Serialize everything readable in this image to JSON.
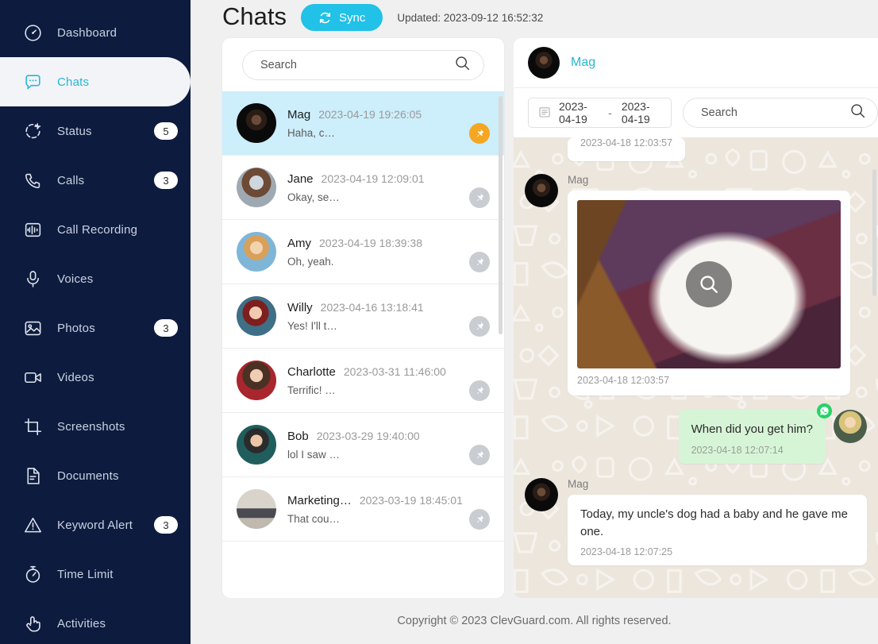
{
  "sidebar": {
    "items": [
      {
        "label": "Dashboard",
        "icon": "dashboard-icon",
        "badge": "",
        "active": false
      },
      {
        "label": "Chats",
        "icon": "chat-bubble-icon",
        "badge": "",
        "active": true
      },
      {
        "label": "Status",
        "icon": "status-plus-icon",
        "badge": "5",
        "active": false
      },
      {
        "label": "Calls",
        "icon": "phone-icon",
        "badge": "3",
        "active": false
      },
      {
        "label": "Call Recording",
        "icon": "waveform-icon",
        "badge": "",
        "active": false
      },
      {
        "label": "Voices",
        "icon": "microphone-icon",
        "badge": "",
        "active": false
      },
      {
        "label": "Photos",
        "icon": "photo-icon",
        "badge": "3",
        "active": false
      },
      {
        "label": "Videos",
        "icon": "video-camera-icon",
        "badge": "",
        "active": false
      },
      {
        "label": "Screenshots",
        "icon": "crop-icon",
        "badge": "",
        "active": false
      },
      {
        "label": "Documents",
        "icon": "document-icon",
        "badge": "",
        "active": false
      },
      {
        "label": "Keyword Alert",
        "icon": "warning-triangle-icon",
        "badge": "3",
        "active": false
      },
      {
        "label": "Time Limit",
        "icon": "stopwatch-icon",
        "badge": "",
        "active": false
      },
      {
        "label": "Activities",
        "icon": "hand-pointer-icon",
        "badge": "",
        "active": false
      }
    ]
  },
  "header": {
    "title": "Chats",
    "sync_label": "Sync",
    "sync_icon": "refresh-icon",
    "updated": "Updated: 2023-09-12 16:52:32"
  },
  "chat_list": {
    "search_placeholder": "Search",
    "search_value": "",
    "search_icon": "search-icon",
    "rows": [
      {
        "name": "Mag",
        "time": "2023-04-19 19:26:05",
        "snippet": "Haha, c…",
        "pinned": true,
        "selected": true,
        "avatar": "mag"
      },
      {
        "name": "Jane",
        "time": "2023-04-19 12:09:01",
        "snippet": "Okay, se…",
        "pinned": false,
        "selected": false,
        "avatar": "jane"
      },
      {
        "name": "Amy",
        "time": "2023-04-19 18:39:38",
        "snippet": "Oh, yeah.",
        "pinned": false,
        "selected": false,
        "avatar": "amy"
      },
      {
        "name": "Willy",
        "time": "2023-04-16 13:18:41",
        "snippet": "Yes! I'll t…",
        "pinned": false,
        "selected": false,
        "avatar": "willy"
      },
      {
        "name": "Charlotte",
        "time": "2023-03-31 11:46:00",
        "snippet": "Terrific! …",
        "pinned": false,
        "selected": false,
        "avatar": "charlotte"
      },
      {
        "name": "Bob",
        "time": "2023-03-29 19:40:00",
        "snippet": "lol I saw …",
        "pinned": false,
        "selected": false,
        "avatar": "bob"
      },
      {
        "name": "Marketing…",
        "time": "2023-03-19 18:45:01",
        "snippet": "That cou…",
        "pinned": false,
        "selected": false,
        "avatar": "group"
      }
    ]
  },
  "conversation": {
    "contact_name": "Mag",
    "calendar_icon": "calendar-icon",
    "date_from": "2023-04-19",
    "date_dash": "-",
    "date_to": "2023-04-19",
    "search_placeholder": "Search",
    "search_value": "",
    "search_icon": "search-icon",
    "messages": [
      {
        "type": "partial",
        "direction": "in",
        "sender": "",
        "time": "2023-04-18 12:03:57"
      },
      {
        "type": "image",
        "direction": "in",
        "sender": "Mag",
        "time": "2023-04-18 12:03:57",
        "overlay_icon": "zoom-search-icon",
        "alt": "white puppy sitting on wooden logs"
      },
      {
        "type": "text",
        "direction": "out",
        "sender": "",
        "text": "When did you get him?",
        "time": "2023-04-18 12:07:14",
        "badge_icon": "whatsapp-icon"
      },
      {
        "type": "text",
        "direction": "in",
        "sender": "Mag",
        "text": "Today, my uncle's dog had a baby and he gave me one.",
        "time": "2023-04-18 12:07:25"
      }
    ]
  },
  "footer": {
    "copyright": "Copyright © 2023 ClevGuard.com. All rights reserved."
  },
  "colors": {
    "sidebar_bg": "#0d1b3e",
    "accent": "#27b7d4",
    "sync_bg": "#21c1e8",
    "selected_row": "#cdeefb",
    "pin_active": "#f5a623",
    "outgoing_bubble": "#d6f5d6",
    "chat_bg": "#ece6dd",
    "whatsapp_green": "#25d366"
  }
}
